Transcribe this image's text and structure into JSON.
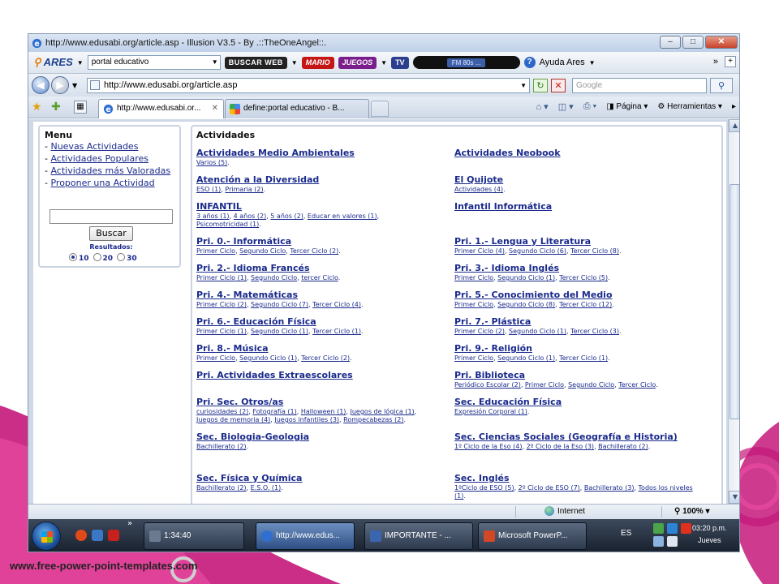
{
  "slide": {
    "footer": "www.free-power-point-templates.com",
    "colors": {
      "magenta": "#c4177a",
      "pink": "#e94ca2",
      "grey": "#d0d0d0"
    }
  },
  "window": {
    "title": "http://www.edusabi.org/article.asp - Illusion V3.5 - By .::TheOneAngel::.",
    "buttons": {
      "minimize": "–",
      "maximize": "□",
      "close": "✕"
    }
  },
  "ares_toolbar": {
    "logo": "ARES",
    "search_value": "portal educativo",
    "buscar_web": "BUSCAR WEB",
    "mario": "MARIO",
    "juegos": "JUEGOS",
    "tv": "TV",
    "radio": "FM 80s ...",
    "help": "Ayuda Ares",
    "more": "»",
    "add": "+"
  },
  "address_bar": {
    "url": "http://www.edusabi.org/article.asp",
    "search_placeholder": "Google"
  },
  "tabs": [
    {
      "label": "http://www.edusabi.or...",
      "close": "✕"
    },
    {
      "label": "define:portal educativo - B..."
    }
  ],
  "command_bar": {
    "page": "Página",
    "tools": "Herramientas"
  },
  "sidebar": {
    "title": "Menu",
    "items": [
      {
        "prefix": "- ",
        "label": "Nuevas Actividades"
      },
      {
        "prefix": "- ",
        "label": "Actividades Populares"
      },
      {
        "prefix": "- ",
        "label": "Actividades más Valoradas"
      },
      {
        "prefix": "- ",
        "label": "Proponer una Actividad"
      }
    ],
    "search_button": "Buscar",
    "results_label": "Resultados:",
    "results_options": [
      "10",
      "20",
      "30"
    ],
    "results_selected": "10"
  },
  "content": {
    "title": "Actividades",
    "categories": [
      {
        "title": "Actividades Medio Ambientales",
        "subs": [
          "Varios (5)"
        ]
      },
      {
        "title": "Actividades Neobook",
        "subs": []
      },
      {
        "title": "Atención a la Diversidad",
        "subs": [
          "ESO (1)",
          "Primaria (2)"
        ]
      },
      {
        "title": "El Quijote",
        "subs": [
          "Actividades (4)"
        ]
      },
      {
        "title": "INFANTIL",
        "subs": [
          "3 años (1)",
          "4 años (2)",
          "5 años (2)",
          "Educar en valores (1)",
          "Psicomotricidad (1)"
        ]
      },
      {
        "title": "Infantil Informática",
        "subs": []
      },
      {
        "title": "Pri. 0.- Informática",
        "subs": [
          "Primer Ciclo",
          "Segundo Ciclo",
          "Tercer Ciclo (2)"
        ]
      },
      {
        "title": "Pri. 1.- Lengua y Literatura",
        "subs": [
          "Primer Ciclo (4)",
          "Segundo Ciclo (6)",
          "Tercer Ciclo (8)"
        ]
      },
      {
        "title": "Pri. 2.- Idioma Francés",
        "subs": [
          "Primer Ciclo (1)",
          "Segundo Ciclo",
          "tercer Ciclo"
        ]
      },
      {
        "title": "Pri. 3.- Idioma Inglés",
        "subs": [
          "Primer Ciclo",
          "Segundo Ciclo (1)",
          "Tercer Ciclo (5)"
        ]
      },
      {
        "title": "Pri. 4.- Matemáticas",
        "subs": [
          "Primer Ciclo (2)",
          "Segundo Ciclo (7)",
          "Tercer Ciclo (4)"
        ]
      },
      {
        "title": "Pri. 5.- Conocimiento del Medio",
        "subs": [
          "Primer Ciclo",
          "Segundo Ciclo (8)",
          "Tercer Ciclo (12)"
        ]
      },
      {
        "title": "Pri. 6.- Educación Física",
        "subs": [
          "Primer Ciclo (1)",
          "Segundo Ciclo (1)",
          "Tercer Ciclo (1)"
        ]
      },
      {
        "title": "Pri. 7.- Plástica",
        "subs": [
          "Primer Ciclo (2)",
          "Segundo Ciclo (1)",
          "Tercer Ciclo (3)"
        ]
      },
      {
        "title": "Pri. 8.- Música",
        "subs": [
          "Primer Ciclo",
          "Segundo Ciclo (1)",
          "Tercer Ciclo (2)"
        ]
      },
      {
        "title": "Pri. 9.- Religión",
        "subs": [
          "Primer Ciclo",
          "Segundo Ciclo (1)",
          "Tercer Ciclo (1)"
        ]
      },
      {
        "title": "Pri. Actividades Extraescolares",
        "subs": []
      },
      {
        "title": "Pri. Biblioteca",
        "subs": [
          "Periódico Escolar (2)",
          "Primer Ciclo",
          "Segundo Ciclo",
          "Tercer Ciclo"
        ]
      },
      {
        "title": "Pri. Sec. Otros/as",
        "subs": [
          "curiosidades (2)",
          "Fotografía (1)",
          "Halloween (1)",
          "Juegos de lógica (1)",
          "Juegos de memoria (4)",
          "Juegos infantiles (3)",
          "Rompecabezas (2)"
        ]
      },
      {
        "title": "Sec. Educación Física",
        "subs": [
          "Expresión Corporal (1)"
        ]
      },
      {
        "title": "Sec. Biologia-Geologia",
        "subs": [
          "Bachillerato (2)"
        ]
      },
      {
        "title": "Sec. Ciencias Sociales (Geografía e Historia)",
        "subs": [
          "1º Ciclo de la Eso (4)",
          "2º Ciclo de la Eso (3)",
          "Bachillerato (2)"
        ]
      },
      {
        "title": "Sec. Física y Química",
        "subs": [
          "Bachillerato (2)",
          "E.S.O. (1)"
        ]
      },
      {
        "title": "Sec. Inglés",
        "subs": [
          "1ºCiclo de ESO (5)",
          "2º Ciclo de ESO (7)",
          "Bachillerato (3)",
          "Todos los niveles (1)"
        ]
      }
    ]
  },
  "status_bar": {
    "zone": "Internet",
    "zoom": "100%"
  },
  "taskbar": {
    "tasks": [
      {
        "label": "1:34:40"
      },
      {
        "label": "http://www.edus..."
      },
      {
        "label": "IMPORTANTE - ..."
      },
      {
        "label": "Microsoft PowerP..."
      }
    ],
    "language": "ES",
    "time": "03:20 p.m.",
    "day": "Jueves"
  }
}
